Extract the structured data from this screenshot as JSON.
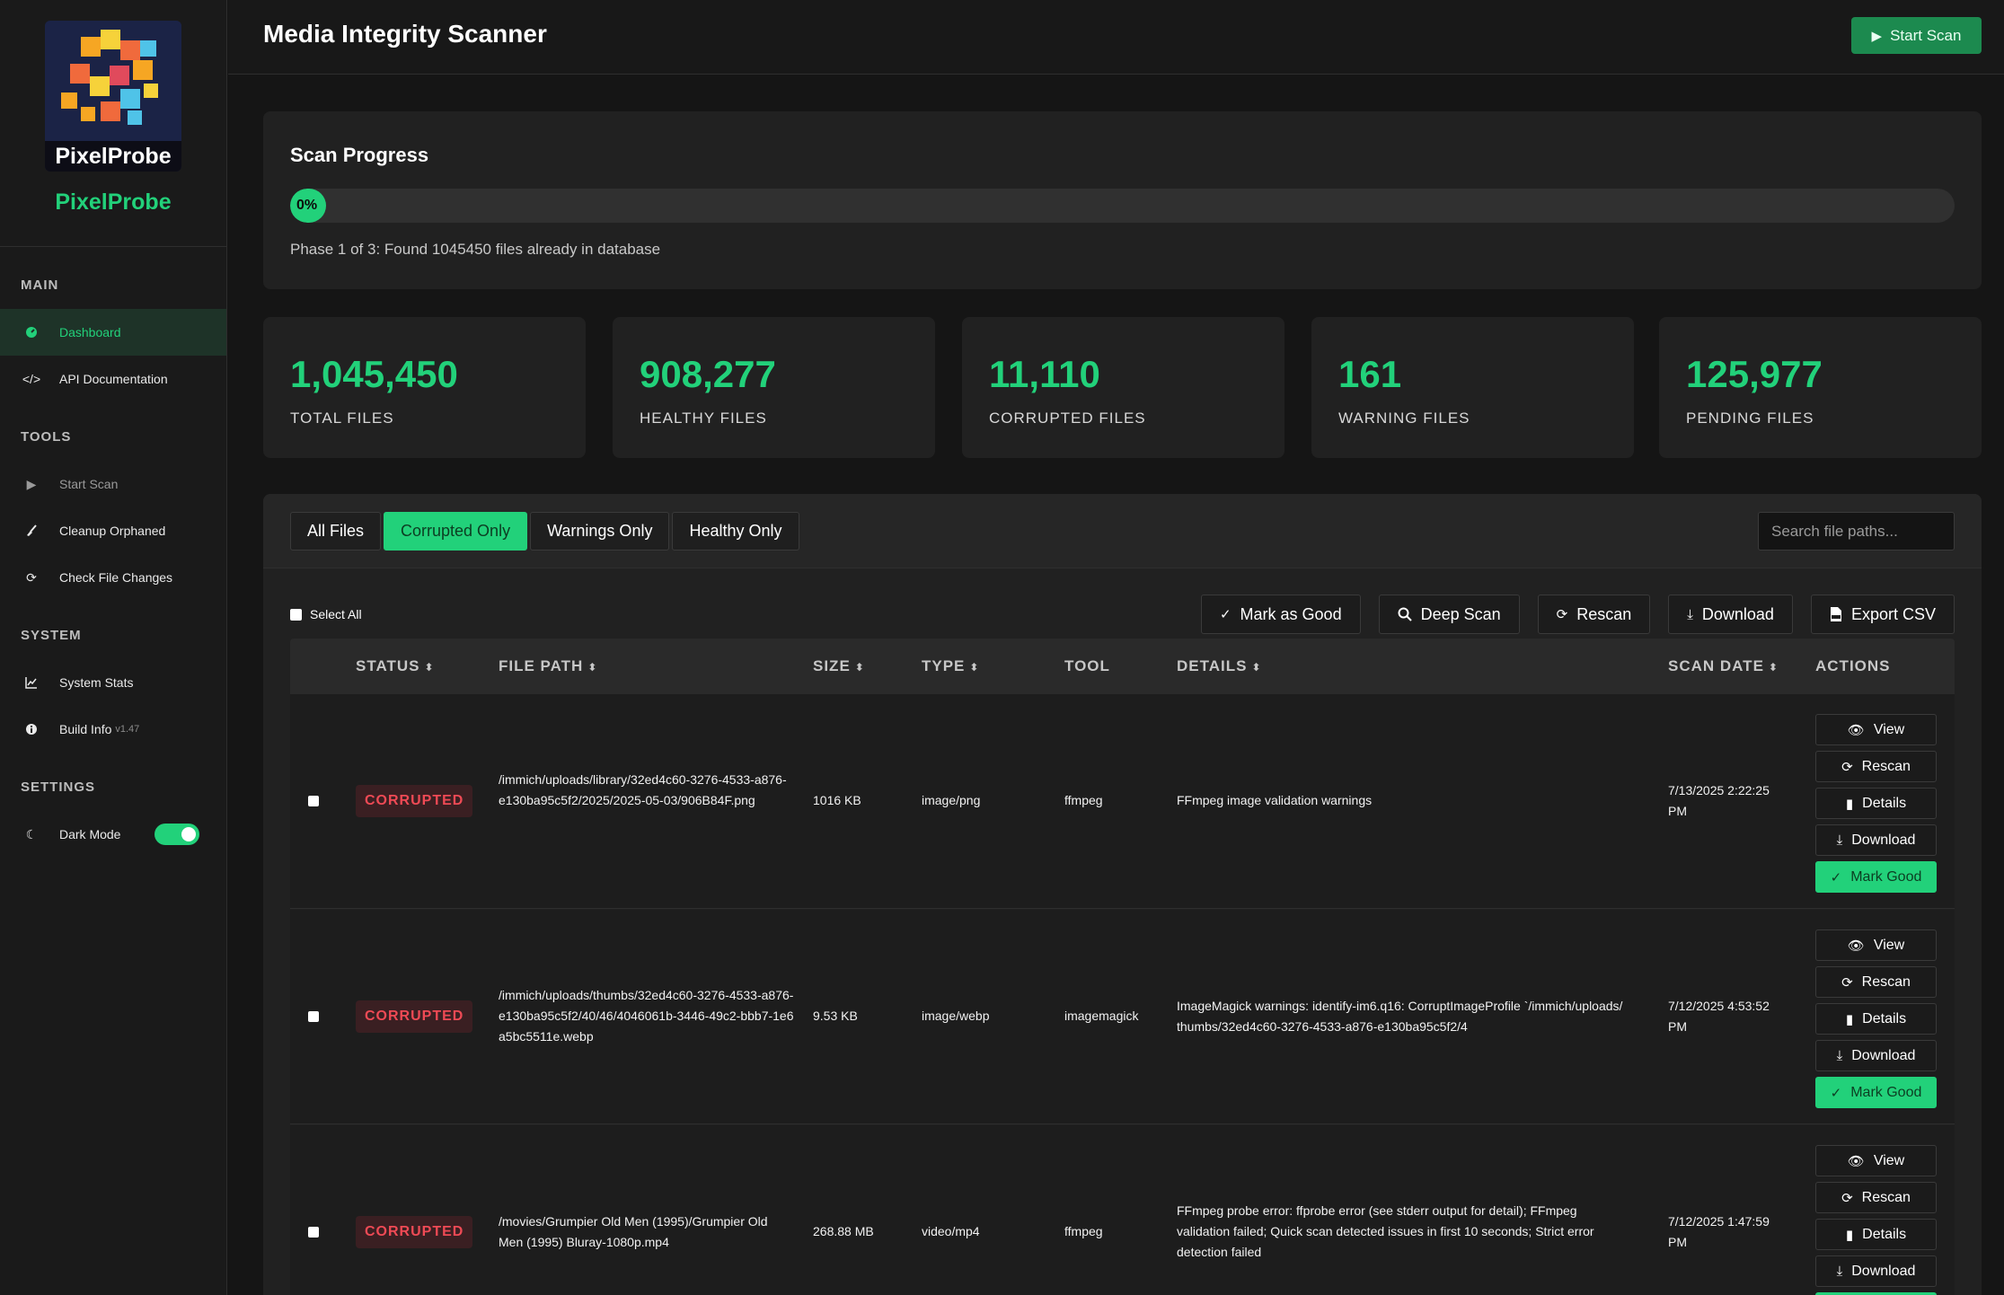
{
  "brand": {
    "logo_text": "PixelProbe",
    "name": "PixelProbe"
  },
  "sidebar": {
    "sections": [
      {
        "heading": "MAIN",
        "items": [
          {
            "label": "Dashboard",
            "icon": "dashboard-icon"
          },
          {
            "label": "API Documentation",
            "icon": "code-icon"
          }
        ]
      },
      {
        "heading": "TOOLS",
        "items": [
          {
            "label": "Start Scan",
            "icon": "play-icon"
          },
          {
            "label": "Cleanup Orphaned",
            "icon": "broom-icon"
          },
          {
            "label": "Check File Changes",
            "icon": "sync-icon"
          }
        ]
      },
      {
        "heading": "SYSTEM",
        "items": [
          {
            "label": "System Stats",
            "icon": "chart-line-icon"
          },
          {
            "label": "Build Info",
            "version": "v1.47",
            "icon": "info-icon"
          }
        ]
      },
      {
        "heading": "SETTINGS",
        "items": [
          {
            "label": "Dark Mode",
            "icon": "moon-icon"
          }
        ]
      }
    ]
  },
  "header": {
    "title": "Media Integrity Scanner",
    "start_scan": "Start Scan"
  },
  "progress": {
    "title": "Scan Progress",
    "percent_label": "0%",
    "fraction": 0,
    "phase_text": "Phase 1 of 3: Found 1045450 files already in database"
  },
  "stats": [
    {
      "value": "1,045,450",
      "label": "TOTAL FILES"
    },
    {
      "value": "908,277",
      "label": "HEALTHY FILES"
    },
    {
      "value": "11,110",
      "label": "CORRUPTED FILES"
    },
    {
      "value": "161",
      "label": "WARNING FILES"
    },
    {
      "value": "125,977",
      "label": "PENDING FILES"
    }
  ],
  "filters": {
    "tabs": [
      "All Files",
      "Corrupted Only",
      "Warnings Only",
      "Healthy Only"
    ],
    "active": "Corrupted Only",
    "search_placeholder": "Search file paths..."
  },
  "toolbar": {
    "select_all": "Select All",
    "mark_good": "Mark as Good",
    "deep_scan": "Deep Scan",
    "rescan": "Rescan",
    "download": "Download",
    "export_csv": "Export CSV"
  },
  "table": {
    "columns": [
      "STATUS",
      "FILE PATH",
      "SIZE",
      "TYPE",
      "TOOL",
      "DETAILS",
      "SCAN DATE",
      "ACTIONS"
    ],
    "row_actions": {
      "view": "View",
      "rescan": "Rescan",
      "details": "Details",
      "download": "Download",
      "mark_good": "Mark Good"
    },
    "rows": [
      {
        "status": "CORRUPTED",
        "path": "/immich/uploads/library/32ed4c60-3276-4533-a876-e130ba95c5f2/2025/2025-05-03/906B84F.png",
        "size": "1016 KB",
        "type": "image/png",
        "tool": "ffmpeg",
        "details": "FFmpeg image validation warnings",
        "date": "7/13/2025 2:22:25 PM"
      },
      {
        "status": "CORRUPTED",
        "path": "/immich/uploads/thumbs/32ed4c60-3276-4533-a876-e130ba95c5f2/40/46/4046061b-3446-49c2-bbb7-1e6a5bc5511e.webp",
        "size": "9.53 KB",
        "type": "image/webp",
        "tool": "imagemagick",
        "details": "ImageMagick warnings: identify-im6.q16: CorruptImageProfile `/immich/uploads/thumbs/32ed4c60-3276-4533-a876-e130ba95c5f2/4",
        "date": "7/12/2025 4:53:52 PM"
      },
      {
        "status": "CORRUPTED",
        "path": "/movies/Grumpier Old Men (1995)/Grumpier Old Men (1995) Bluray-1080p.mp4",
        "size": "268.88 MB",
        "type": "video/mp4",
        "tool": "ffmpeg",
        "details": "FFmpeg probe error: ffprobe error (see stderr output for detail); FFmpeg validation failed; Quick scan detected issues in first 10 seconds; Strict error detection failed",
        "date": "7/12/2025 1:47:59 PM"
      }
    ]
  }
}
